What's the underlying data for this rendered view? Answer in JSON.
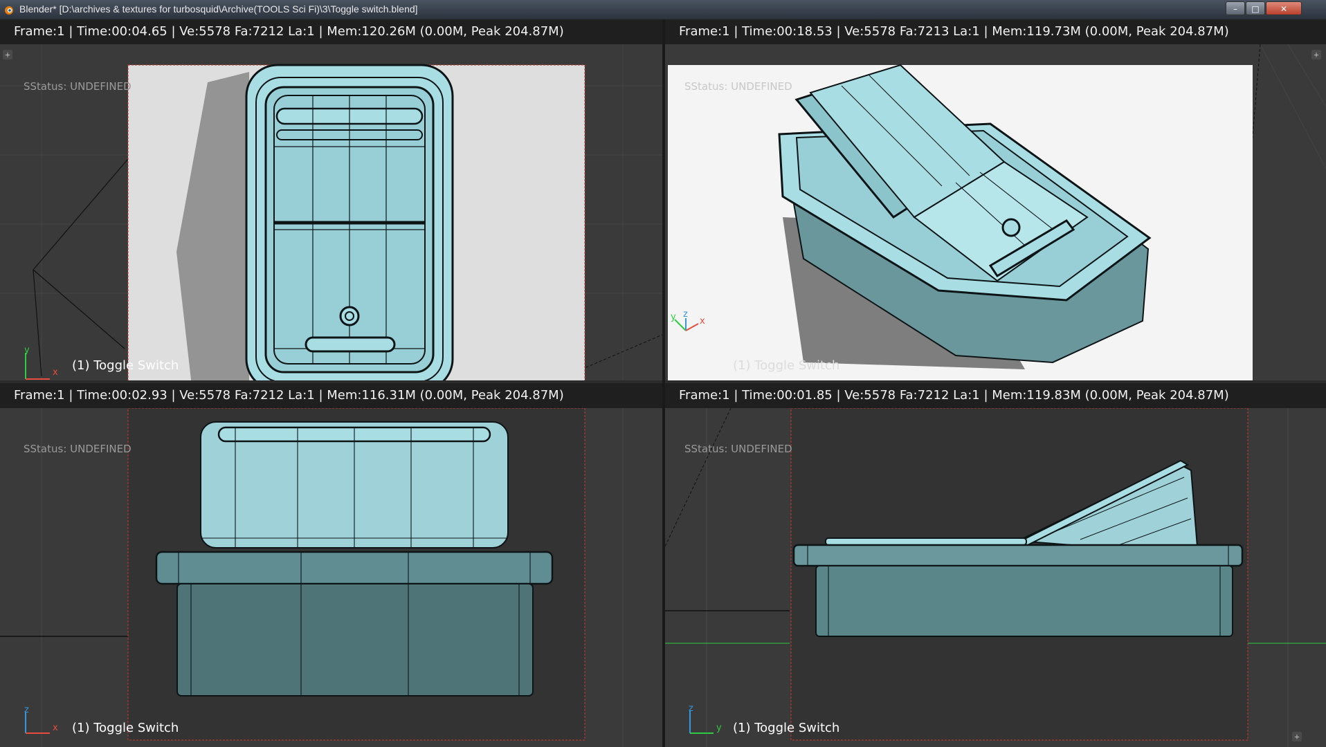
{
  "window": {
    "title": "Blender* [D:\\archives & textures for turbosquid\\Archive(TOOLS Sci Fi)\\3\\Toggle switch.blend]",
    "minimize_glyph": "–",
    "maximize_glyph": "□",
    "close_glyph": "✕"
  },
  "viewports": [
    {
      "name": "top-left",
      "info": "Frame:1 | Time:00:04.65 | Ve:5578 Fa:7212 La:1 | Mem:120.26M (0.00M, Peak 204.87M)",
      "status": "SStatus: UNDEFINED",
      "object_label": "(1) Toggle Switch",
      "axis": [
        "y",
        "x"
      ],
      "render_bg": "light"
    },
    {
      "name": "top-right",
      "info": "Frame:1 | Time:00:18.53 | Ve:5578 Fa:7213 La:1 | Mem:119.73M (0.00M, Peak 204.87M)",
      "status": "SStatus: UNDEFINED",
      "object_label": "(1) Toggle Switch",
      "axis": [
        "y",
        "z",
        "x"
      ],
      "render_bg": "white"
    },
    {
      "name": "bottom-left",
      "info": "Frame:1 | Time:00:02.93 | Ve:5578 Fa:7212 La:1 | Mem:116.31M (0.00M, Peak 204.87M)",
      "status": "SStatus: UNDEFINED",
      "object_label": "(1) Toggle Switch",
      "axis": [
        "z",
        "x"
      ],
      "render_bg": "dark"
    },
    {
      "name": "bottom-right",
      "info": "Frame:1 | Time:00:01.85 | Ve:5578 Fa:7212 La:1 | Mem:119.83M (0.00M, Peak 204.87M)",
      "status": "SStatus: UNDEFINED",
      "object_label": "(1) Toggle Switch",
      "axis": [
        "z",
        "y"
      ],
      "render_bg": "dark"
    }
  ],
  "colors": {
    "mesh_fill": "#a8dde3",
    "mesh_dark": "#5e8c90",
    "wire": "#0d1416",
    "render_border": "#c0392b"
  },
  "icons": {
    "app": "blender-logo-icon",
    "corner_plus": "plus-icon"
  }
}
